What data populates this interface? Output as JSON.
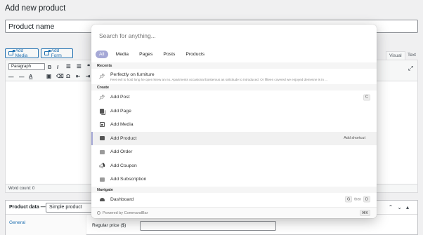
{
  "page": {
    "title": "Add new product",
    "product_name_placeholder": "Product name"
  },
  "editor": {
    "add_media_label": "Add Media",
    "add_form_label": "Add Form",
    "visual_tab": "Visual",
    "text_tab": "Text",
    "format_select": "Paragraph",
    "word_count": "Word count: 0"
  },
  "product_data": {
    "label": "Product data —",
    "type_value": "Simple product",
    "general_tab": "General",
    "regular_price_label": "Regular price ($)"
  },
  "commandbar": {
    "search_placeholder": "Search for anything...",
    "tabs": [
      {
        "label": "All",
        "active": true
      },
      {
        "label": "Media",
        "active": false
      },
      {
        "label": "Pages",
        "active": false
      },
      {
        "label": "Posts",
        "active": false
      },
      {
        "label": "Products",
        "active": false
      }
    ],
    "recents_heading": "Recents",
    "recent_item": {
      "label": "Perfectly on furniture",
      "excerpt": "Feet evil to hold long he open knew an no. Apartments occasional boisterous as solicitude to introduced. Or fifteen covered we enjoyed demesne is in ..."
    },
    "create_heading": "Create",
    "create_items": [
      {
        "label": "Add Post",
        "icon": "pin-icon",
        "shortcut": "C"
      },
      {
        "label": "Add Page",
        "icon": "pages-icon"
      },
      {
        "label": "Add Media",
        "icon": "media-icon"
      },
      {
        "label": "Add Product",
        "icon": "product-icon",
        "hint": "Add shortcut",
        "selected": true
      },
      {
        "label": "Add Order",
        "icon": "order-icon"
      },
      {
        "label": "Add Coupon",
        "icon": "megaphone-icon"
      },
      {
        "label": "Add Subscription",
        "icon": "subscription-icon"
      }
    ],
    "navigate_heading": "Navigate",
    "navigate_items": [
      {
        "label": "Dashboard",
        "icon": "dashboard-icon",
        "keys": [
          "G",
          "D"
        ],
        "then": "then"
      }
    ],
    "footer_text": "Powered by CommandBar",
    "footer_shortcut": "⌘K"
  }
}
